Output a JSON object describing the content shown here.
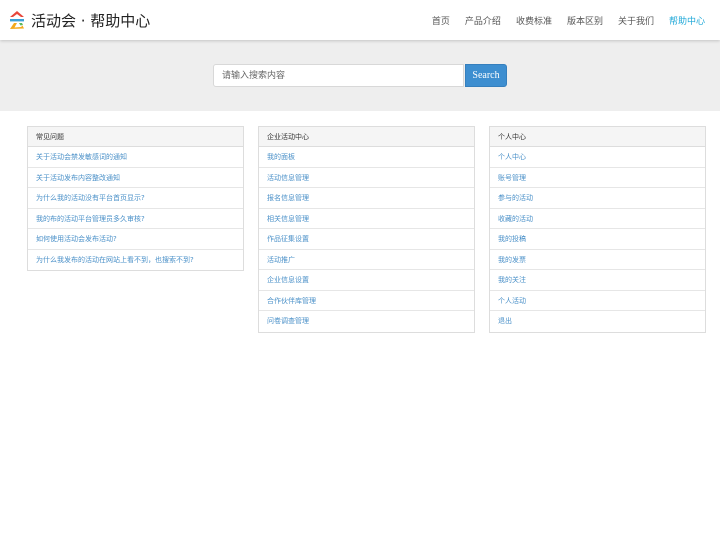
{
  "header": {
    "brand": "活动会 · 帮助中心",
    "logo_icon": "colorful-stacked-logo-icon",
    "nav": [
      {
        "label": "首页",
        "active": false
      },
      {
        "label": "产品介绍",
        "active": false
      },
      {
        "label": "收费标准",
        "active": false
      },
      {
        "label": "版本区别",
        "active": false
      },
      {
        "label": "关于我们",
        "active": false
      },
      {
        "label": "帮助中心",
        "active": true
      }
    ],
    "active_color": "#1fa8d8"
  },
  "search": {
    "placeholder": "请输入搜索内容",
    "value": "",
    "button_label": "Search",
    "button_color": "#3d8ed0"
  },
  "panels": [
    {
      "title": "常见问题",
      "items": [
        "关于活动会禁发敏感词的通知",
        "关于活动发布内容整改通知",
        "为什么我的活动没有平台首页显示?",
        "我的布的活动平台管理员多久审核?",
        "如何使用活动会发布活动?",
        "为什么我发布的活动在网站上看不到，也搜索不到?"
      ]
    },
    {
      "title": "企业活动中心",
      "items": [
        "我的面板",
        "活动信息管理",
        "报名信息管理",
        "相关信息管理",
        "作品征集设置",
        "活动推广",
        "企业信息设置",
        "合作伙伴库管理",
        "问卷调查管理"
      ]
    },
    {
      "title": "个人中心",
      "items": [
        "个人中心",
        "账号管理",
        "参与的活动",
        "收藏的活动",
        "我的投稿",
        "我的发票",
        "我的关注",
        "个人活动",
        "退出"
      ]
    }
  ]
}
